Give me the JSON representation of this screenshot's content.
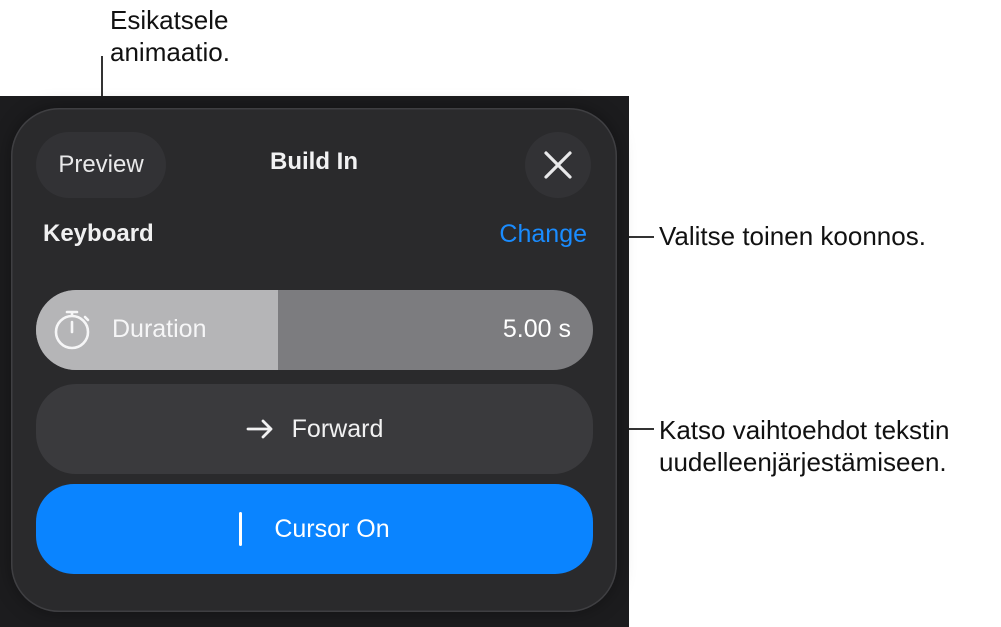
{
  "callouts": {
    "preview_line1": "Esikatsele",
    "preview_line2": "animaatio.",
    "change": "Valitse toinen koonnos.",
    "forward_line1": "Katso vaihtoehdot tekstin",
    "forward_line2": "uudelleenjärjestämiseen."
  },
  "header": {
    "preview_label": "Preview",
    "title": "Build In",
    "close_icon": "close-icon"
  },
  "build": {
    "name": "Keyboard",
    "change_label": "Change"
  },
  "duration": {
    "label": "Duration",
    "value": "5.00 s",
    "icon": "timer-icon",
    "slider_fraction": 0.435
  },
  "direction": {
    "label": "Forward",
    "icon": "arrow-right-icon"
  },
  "cursor": {
    "label": "Cursor On",
    "icon": "text-cursor-icon"
  },
  "colors": {
    "accent": "#0a84ff",
    "link": "#1a8cff",
    "panel": "#2a2a2c"
  }
}
